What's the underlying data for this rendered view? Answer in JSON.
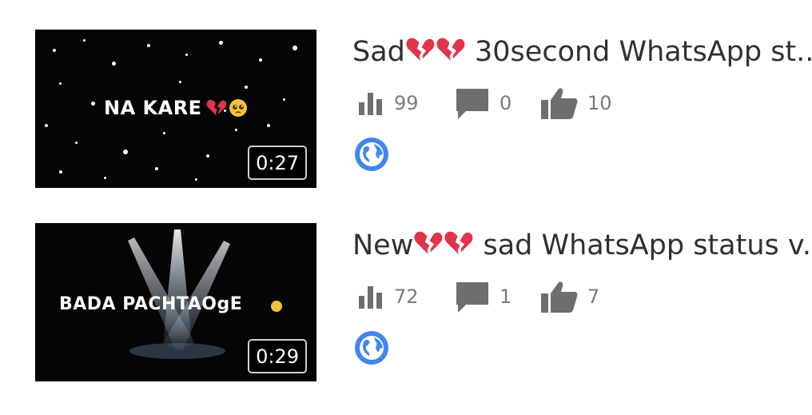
{
  "videos": [
    {
      "thumbnail_text": "NA KARE",
      "duration": "0:27",
      "title_prefix": "Sad",
      "title_suffix": " 30second WhatsApp st..",
      "views": "99",
      "comments": "0",
      "likes": "10",
      "visibility_icon": "globe-icon"
    },
    {
      "thumbnail_text": "BADA PACHTAOgE",
      "duration": "0:29",
      "title_prefix": "New",
      "title_suffix": " sad WhatsApp status v.",
      "views": "72",
      "comments": "1",
      "likes": "7",
      "visibility_icon": "globe-icon"
    }
  ],
  "colors": {
    "icon_gray": "#6e6e6e",
    "text_dark": "#303030",
    "globe_blue": "#4285f4",
    "heart_red": "#e0344a"
  }
}
